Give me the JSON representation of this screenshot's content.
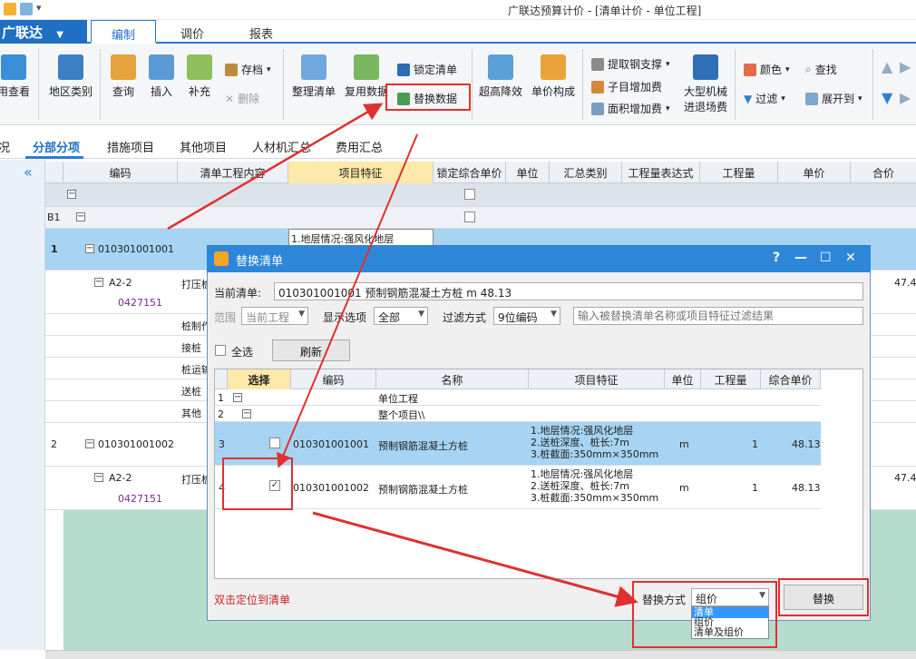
{
  "window": {
    "title": "广联达预算计价 - [清单计价 - 单位工程]"
  },
  "brand": {
    "name": "广联达"
  },
  "main_tabs": [
    "编制",
    "调价",
    "报表"
  ],
  "ribbon": {
    "view": "用查看",
    "region": "地区类别",
    "query": "查询",
    "insert": "插入",
    "supplement": "补充",
    "archive": "存档",
    "delete": "删除",
    "organize": "整理清单",
    "reuse": "复用数据",
    "lock": "锁定清单",
    "replace_data": "替换数据",
    "super_high": "超高降效",
    "unit_price": "单价构成",
    "steel": "提取钢支撑",
    "sub_fee": "子目增加费",
    "area_fee": "面积增加费",
    "machine_1": "大型机械",
    "machine_2": "进退场费",
    "color": "颜色",
    "filter": "过滤",
    "find": "查找",
    "expand": "展开到"
  },
  "sub_tabs": [
    "况",
    "分部分项",
    "措施项目",
    "其他项目",
    "人材机汇总",
    "费用汇总"
  ],
  "grid": {
    "headers": [
      "编码",
      "清单工程内容",
      "项目特征",
      "锁定综合单价",
      "单位",
      "汇总类别",
      "工程量表达式",
      "工程量",
      "单价",
      "合价"
    ],
    "row_b1": "B1",
    "row1": {
      "num": "1",
      "code": "010301001001",
      "feature": "1.地层情况:强风化地层"
    },
    "row1_sub": {
      "code": "A2-2",
      "code2": "0427151",
      "content": "打压桩",
      "price": "47.4"
    },
    "row1_items": [
      "桩制作",
      "接桩",
      "桩运输",
      "送桩",
      "其他"
    ],
    "row2": {
      "num": "2",
      "code": "010301001002"
    },
    "row2_sub": {
      "code": "A2-2",
      "code2": "0427151",
      "content": "打压桩",
      "price": "47.4"
    }
  },
  "dialog": {
    "title": "替换清单",
    "current_label": "当前清单:",
    "current_value": "010301001001 预制钢筋混凝土方桩 m 48.13",
    "scope_label": "范围",
    "scope_value": "当前工程",
    "display_label": "显示选项",
    "display_value": "全部",
    "filter_label": "过滤方式",
    "filter_value": "9位编码",
    "filter_placeholder": "输入被替换清单名称或项目特征过滤结果",
    "select_all": "全选",
    "refresh": "刷新",
    "headers": [
      "选择",
      "编码",
      "名称",
      "项目特征",
      "单位",
      "工程量",
      "综合单价"
    ],
    "rows": [
      {
        "num": "1",
        "name": "单位工程"
      },
      {
        "num": "2",
        "name": "整个项目\\\\"
      },
      {
        "num": "3",
        "code": "010301001001",
        "name": "预制钢筋混凝土方桩",
        "features": [
          "1.地层情况:强风化地层",
          "2.送桩深度、桩长:7m",
          "3.桩截面:350mm×350mm"
        ],
        "unit": "m",
        "qty": "1",
        "price": "48.13",
        "checked": false
      },
      {
        "num": "4",
        "code": "010301001002",
        "name": "预制钢筋混凝土方桩",
        "features": [
          "1.地层情况:强风化地层",
          "2.送桩深度、桩长:7m",
          "3.桩截面:350mm×350mm"
        ],
        "unit": "m",
        "qty": "1",
        "price": "48.13",
        "checked": true
      }
    ],
    "hint": "双击定位到清单",
    "replace_mode_label": "替换方式",
    "replace_mode_value": "组价",
    "replace_mode_options": [
      "清单",
      "组价",
      "清单及组价"
    ],
    "replace_button": "替换",
    "check_mark": "✓",
    "ctl_help": "?",
    "ctl_min": "—",
    "ctl_max": "☐",
    "ctl_close": "✕"
  },
  "colors": {
    "accent": "#1f6fc5",
    "dialog_bar": "#2e86d8",
    "highlight_row": "#a6d4f2",
    "annotation": "#e03030"
  }
}
